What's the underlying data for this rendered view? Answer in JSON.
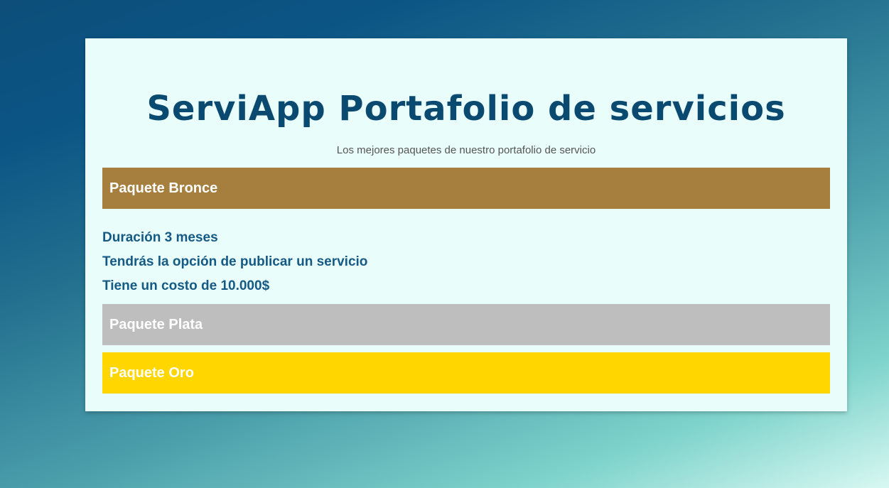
{
  "header": {
    "title": "ServiApp Portafolio de servicios",
    "subtitle": "Los mejores paquetes de nuestro portafolio de servicio"
  },
  "packages": [
    {
      "label": "Paquete Bronce",
      "color": "#a67f3f",
      "expanded": true,
      "details": [
        "Duración 3 meses",
        "Tendrás la opción de publicar un servicio",
        "Tiene un costo de 10.000$"
      ]
    },
    {
      "label": "Paquete Plata",
      "color": "#bebebe",
      "expanded": false
    },
    {
      "label": "Paquete Oro",
      "color": "#ffd600",
      "expanded": false
    }
  ],
  "colors": {
    "card_background": "#e9fdfb",
    "title": "#0b4a70",
    "detail_text": "#145a85"
  }
}
